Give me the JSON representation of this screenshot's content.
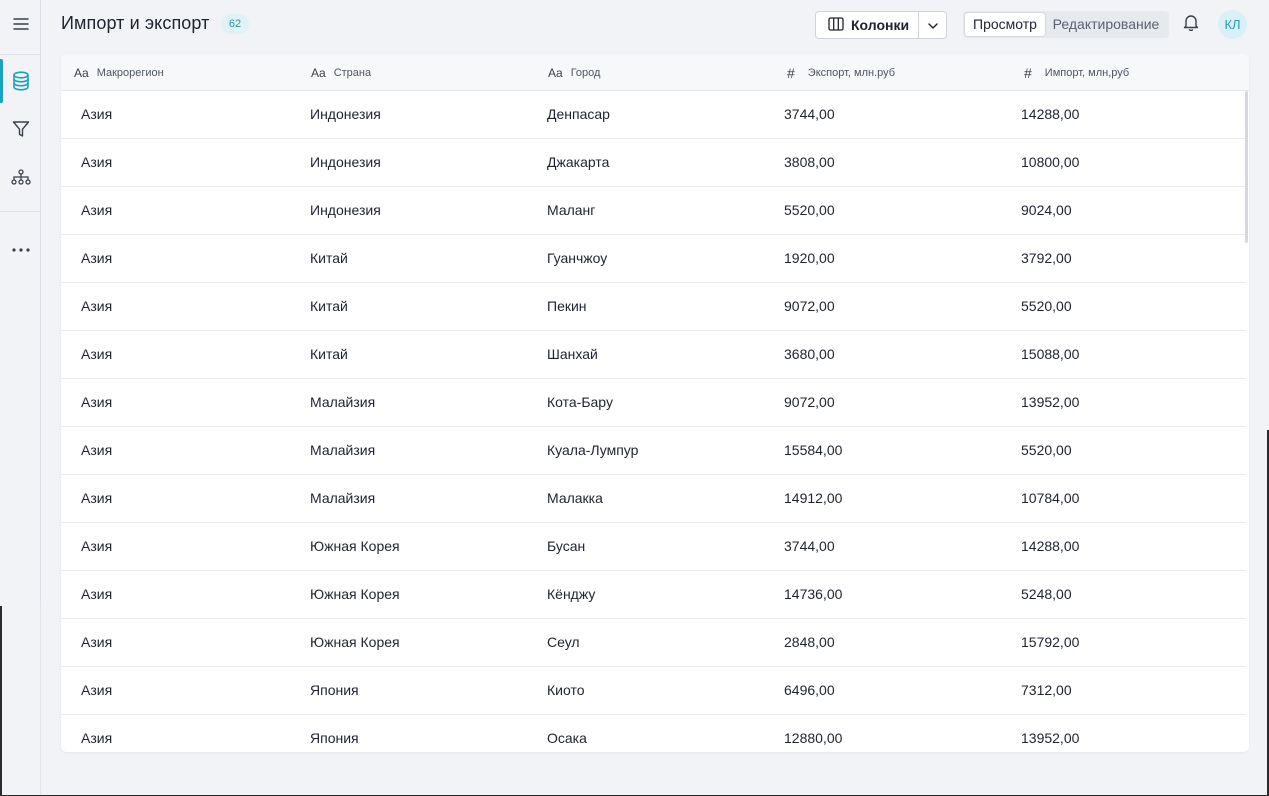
{
  "header": {
    "title": "Импорт и экспорт",
    "count_badge": "62",
    "columns_button": "Колонки",
    "mode_view": "Просмотр",
    "mode_edit": "Редактирование",
    "avatar_initials": "КЛ"
  },
  "sidebar": {
    "items": [
      {
        "icon": "menu-icon"
      },
      {
        "icon": "database-icon",
        "active": true
      },
      {
        "icon": "filter-icon"
      },
      {
        "icon": "hierarchy-icon"
      },
      {
        "icon": "more-icon"
      }
    ]
  },
  "table": {
    "columns": [
      {
        "type_label": "Aa",
        "label": "Макрорегион"
      },
      {
        "type_label": "Aa",
        "label": "Страна"
      },
      {
        "type_label": "Aa",
        "label": "Город"
      },
      {
        "type_label": "#",
        "label": "Экспорт, млн.руб"
      },
      {
        "type_label": "#",
        "label": "Импорт, млн,руб"
      }
    ],
    "rows": [
      [
        "Азия",
        "Индонезия",
        "Денпасар",
        "3744,00",
        "14288,00"
      ],
      [
        "Азия",
        "Индонезия",
        "Джакарта",
        "3808,00",
        "10800,00"
      ],
      [
        "Азия",
        "Индонезия",
        "Маланг",
        "5520,00",
        "9024,00"
      ],
      [
        "Азия",
        "Китай",
        "Гуанчжоу",
        "1920,00",
        "3792,00"
      ],
      [
        "Азия",
        "Китай",
        "Пекин",
        "9072,00",
        "5520,00"
      ],
      [
        "Азия",
        "Китай",
        "Шанхай",
        "3680,00",
        "15088,00"
      ],
      [
        "Азия",
        "Малайзия",
        "Кота-Бару",
        "9072,00",
        "13952,00"
      ],
      [
        "Азия",
        "Малайзия",
        "Куала-Лумпур",
        "15584,00",
        "5520,00"
      ],
      [
        "Азия",
        "Малайзия",
        "Малакка",
        "14912,00",
        "10784,00"
      ],
      [
        "Азия",
        "Южная Корея",
        "Бусан",
        "3744,00",
        "14288,00"
      ],
      [
        "Азия",
        "Южная Корея",
        "Кёнджу",
        "14736,00",
        "5248,00"
      ],
      [
        "Азия",
        "Южная Корея",
        "Сеул",
        "2848,00",
        "15792,00"
      ],
      [
        "Азия",
        "Япония",
        "Киото",
        "6496,00",
        "7312,00"
      ],
      [
        "Азия",
        "Япония",
        "Осака",
        "12880,00",
        "13952,00"
      ]
    ]
  },
  "colors": {
    "accent": "#19a3c1",
    "badge_bg": "#dff2f6",
    "background": "#f1f3f6"
  }
}
